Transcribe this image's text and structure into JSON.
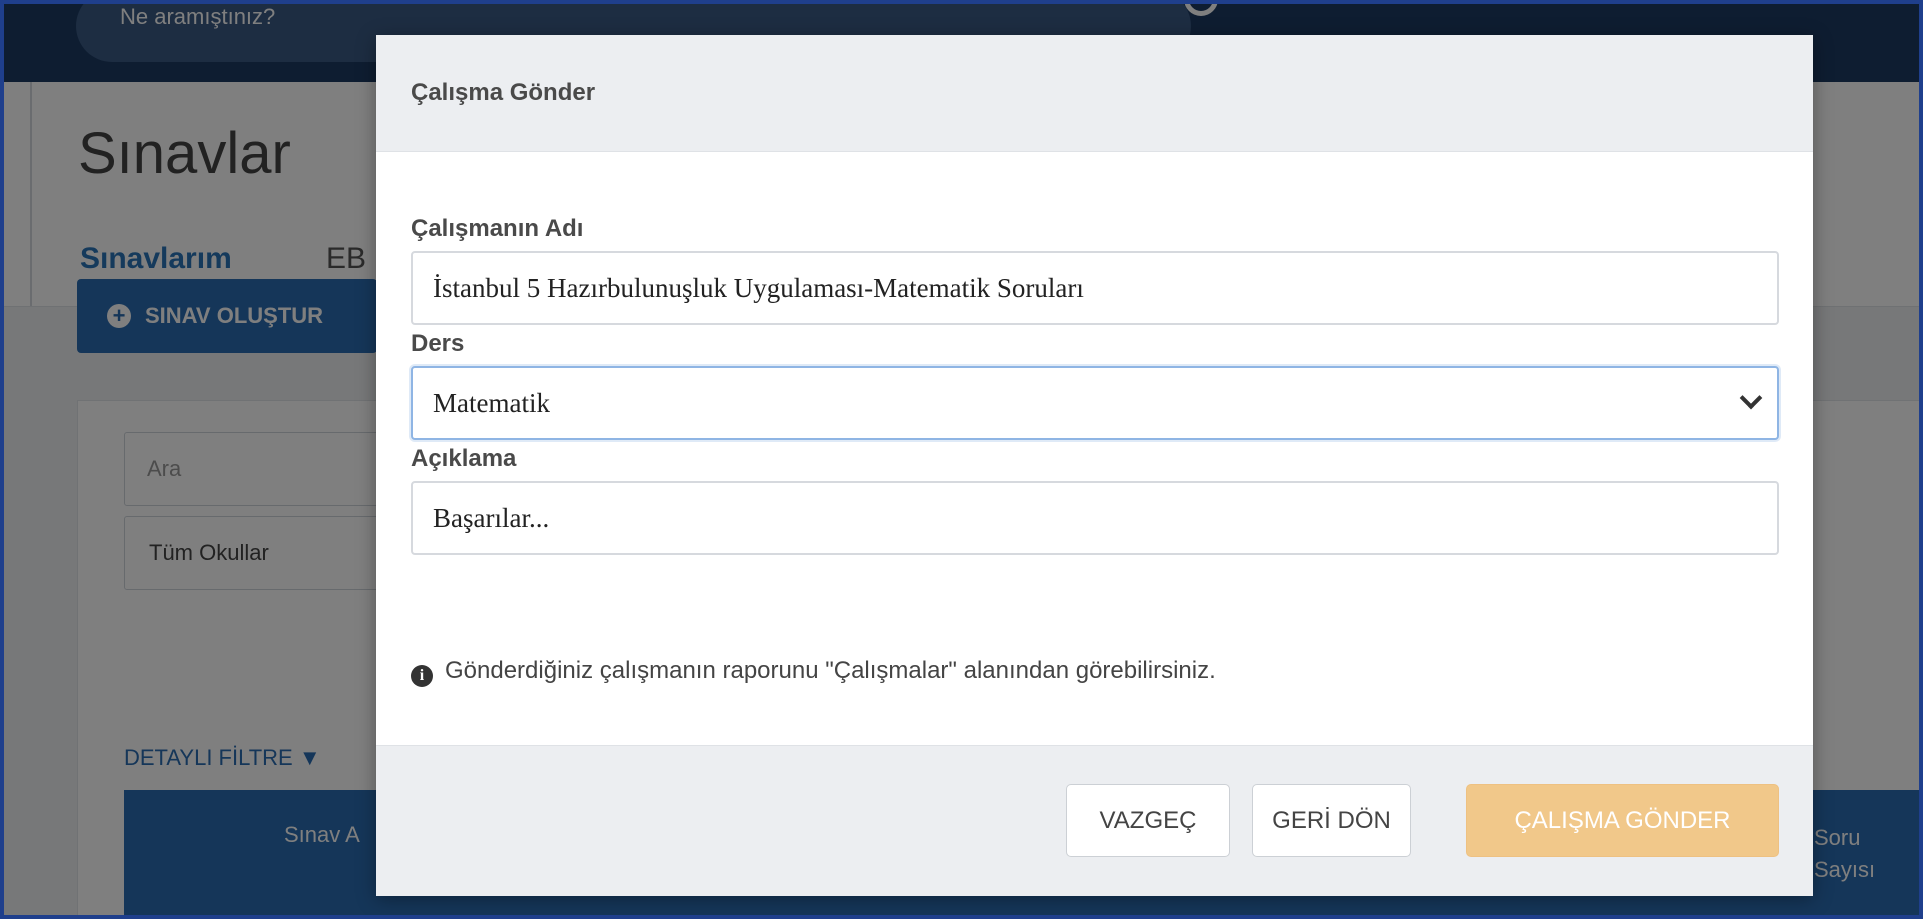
{
  "header": {
    "search_placeholder": "Ne aramıştınız?"
  },
  "page": {
    "title": "Sınavlar",
    "tabs": [
      {
        "label": "Sınavlarım",
        "active": true
      },
      {
        "label": "EB",
        "active": false
      }
    ],
    "create_button": "SINAV OLUŞTUR",
    "filter_search_placeholder": "Ara",
    "school_select": "Tüm Okullar",
    "detail_filter": "DETAYLI FİLTRE",
    "table_headers": [
      "Sınav A",
      "Soru Sayısı"
    ],
    "accent_color": "#2a6db2"
  },
  "modal": {
    "title": "Çalışma Gönder",
    "name_label": "Çalışmanın Adı",
    "name_value": "İstanbul 5 Hazırbulunuşluk Uygulaması-Matematik Soruları",
    "course_label": "Ders",
    "course_value": "Matematik",
    "description_label": "Açıklama",
    "description_value": "Başarılar...",
    "info_text": "Gönderdiğiniz çalışmanın raporunu \"Çalışmalar\" alanından görebilirsiniz.",
    "buttons": {
      "cancel": "VAZGEÇ",
      "back": "GERİ DÖN",
      "submit": "ÇALIŞMA GÖNDER"
    },
    "submit_color": "#f1c88a"
  }
}
